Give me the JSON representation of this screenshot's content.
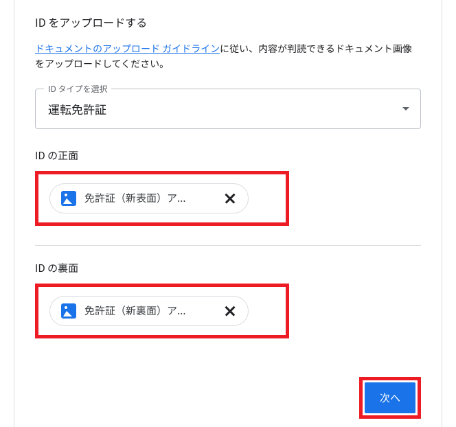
{
  "section_title": "ID をアップロードする",
  "instruction": {
    "link_text": "ドキュメントのアップロード ガイドライン",
    "after_text": "に従い、内容が判読できるドキュメント画像をアップロードしてください。"
  },
  "id_type": {
    "label": "ID タイプを選択",
    "value": "運転免許証"
  },
  "front": {
    "label": "ID の正面",
    "file_name": "免許証（新表面）ア..."
  },
  "back": {
    "label": "ID の裏面",
    "file_name": "免許証（新裏面）ア..."
  },
  "next_button": "次へ"
}
